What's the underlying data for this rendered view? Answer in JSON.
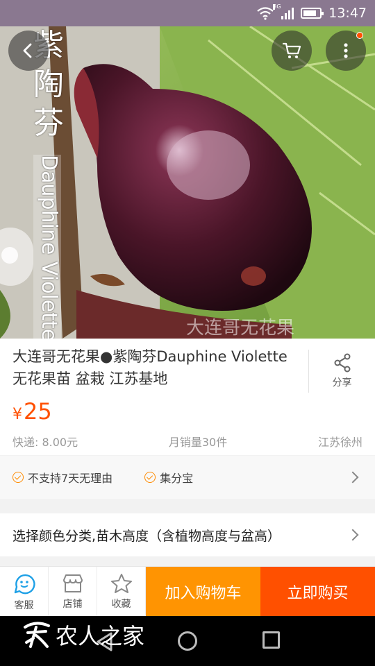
{
  "status_bar": {
    "time": "13:47",
    "network": "3G",
    "icons": [
      "wifi-icon",
      "signal-icon",
      "battery-icon"
    ]
  },
  "hero": {
    "image_caption_cn": "紫陶芬",
    "image_caption_en": "Dauphine Violette",
    "watermark": "大连哥无花果",
    "buttons": [
      "back-arrow-icon",
      "cart-icon",
      "more-icon"
    ]
  },
  "product": {
    "title": "大连哥无花果●紫陶芬Dauphine Violette 无花果苗 盆栽 江苏基地",
    "share_label": "分享",
    "currency": "¥",
    "price": "25",
    "shipping": "快递: 8.00元",
    "monthly_sales": "月销量30件",
    "location": "江苏徐州"
  },
  "services": {
    "items": [
      "不支持7天无理由",
      "集分宝"
    ]
  },
  "sku": {
    "label": "选择颜色分类,苗木高度（含植物高度与盆高）"
  },
  "bottom_bar": {
    "tabs": [
      {
        "label": "客服",
        "icon": "customer-service-icon"
      },
      {
        "label": "店铺",
        "icon": "shop-icon"
      },
      {
        "label": "收藏",
        "icon": "star-icon"
      }
    ],
    "add_to_cart": "加入购物车",
    "buy_now": "立即购买"
  },
  "nav_bar": {
    "brand": "农人之家"
  },
  "colors": {
    "accent": "#ff5000",
    "cart_orange": "#ff9402",
    "tab_icon_blue": "#1ea0e6",
    "status_bar": "#8a7890"
  }
}
